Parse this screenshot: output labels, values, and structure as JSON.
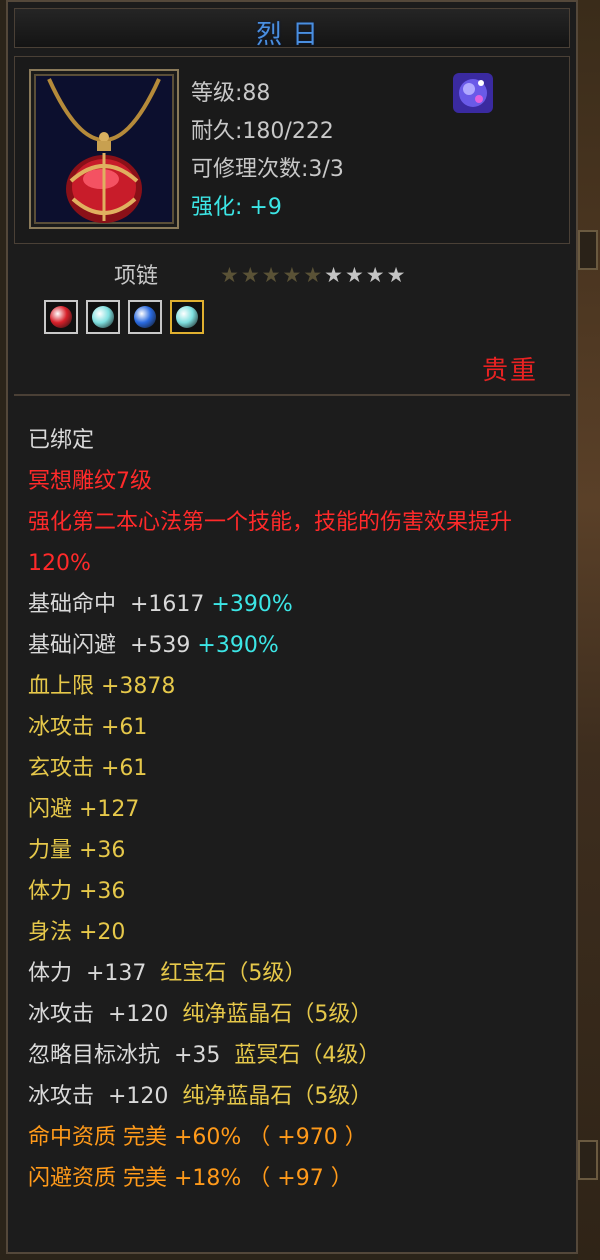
{
  "item": {
    "name": "烈日",
    "level": "等级:88",
    "durability": "耐久:180/222",
    "repairs": "可修理次数:3/3",
    "enhance": "强化: +9",
    "type": "项链",
    "rarity": "贵重",
    "stars_total": 9,
    "stars_filled": 5
  },
  "gems": [
    {
      "name": "red-gem",
      "color": "#d8202a"
    },
    {
      "name": "cyan-gem",
      "color": "#7fe0e0"
    },
    {
      "name": "blue-gem",
      "color": "#2a6ae0"
    },
    {
      "name": "cyan-gem",
      "color": "#7fe0e0"
    }
  ],
  "colors": {
    "title": "#4a8fe0",
    "cyan": "#3ce6e6",
    "red": "#ff2a2a",
    "gold": "#e6c84a",
    "orange": "#ff9a1a"
  },
  "lines": {
    "bound": "已绑定",
    "carve": "冥想雕纹7级",
    "effect": "强化第二本心法第一个技能，技能的伤害效果提升120%",
    "hit_label": "基础命中  +1617",
    "hit_pct": "+390%",
    "dodge_label": "基础闪避  +539",
    "dodge_pct": "+390%",
    "hp": "血上限  +3878",
    "ice_atk": "冰攻击  +61",
    "xuan_atk": "玄攻击  +61",
    "dodge": "闪避  +127",
    "str": "力量  +36",
    "vit": "体力  +36",
    "agi": "身法  +20",
    "gem1_stat": "体力  +137  ",
    "gem1_name": "红宝石（5级）",
    "gem2_stat": "冰攻击  +120  ",
    "gem2_name": "纯净蓝晶石（5级）",
    "gem3_stat": "忽略目标冰抗  +35  ",
    "gem3_name": "蓝冥石（4级）",
    "gem4_stat": "冰攻击  +120  ",
    "gem4_name": "纯净蓝晶石（5级）",
    "q1": "命中资质    完美  +60%  （ +970 ）",
    "q2": "闪避资质    完美  +18%  （ +97 ）"
  }
}
